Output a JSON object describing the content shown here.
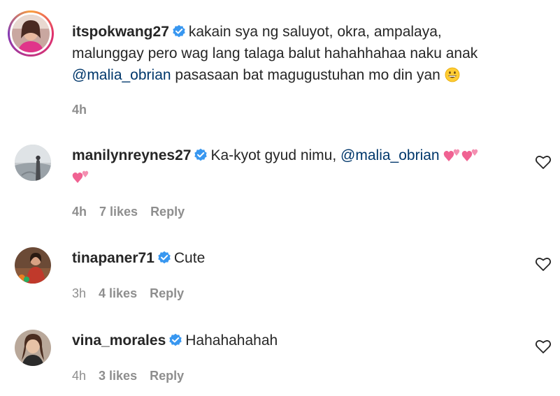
{
  "comments": [
    {
      "username": "itspokwang27",
      "line1": "kakain sya ng saluyot, okra, ampalaya,",
      "line2": "malunggay pero wag lang talaga balut hahahhahaa naku anak",
      "mention": "@malia_obrian",
      "line3_rest": "pasasaan bat magugustuhan mo din yan",
      "emoji": "grinning-face-emoji",
      "time": "4h"
    },
    {
      "username": "manilynreynes27",
      "text": "Ka-kyot gyud nimu,",
      "mention": "@malia_obrian",
      "emoji": "two-hearts-emoji",
      "time": "4h",
      "likes": "7 likes",
      "reply": "Reply"
    },
    {
      "username": "tinapaner71",
      "text": "Cute",
      "time": "3h",
      "likes": "4 likes",
      "reply": "Reply"
    },
    {
      "username": "vina_morales",
      "text": "Hahahahahah",
      "time": "4h",
      "likes": "3 likes",
      "reply": "Reply"
    }
  ],
  "colors": {
    "verified": "#3897f0",
    "mention": "#00376b",
    "meta": "#8e8e8e",
    "heart_emoji": "#f06292"
  }
}
